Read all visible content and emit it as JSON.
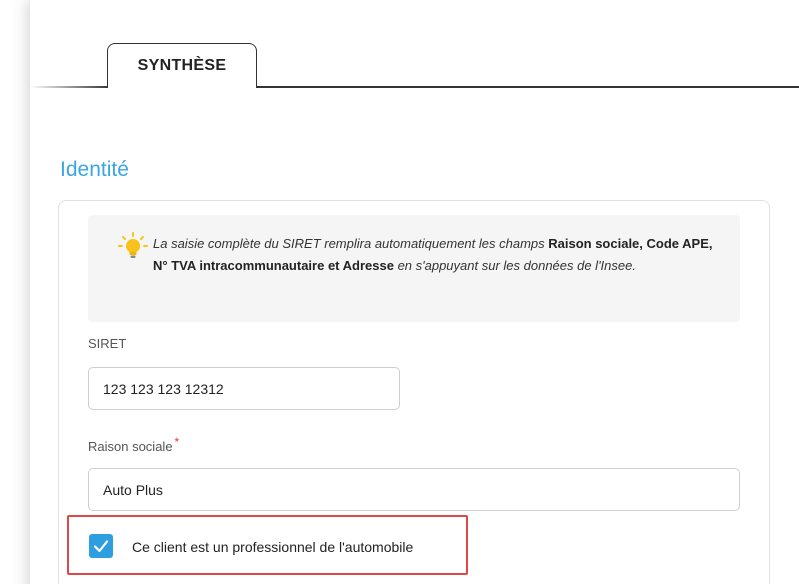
{
  "tabs": [
    {
      "label": "SYNTHÈSE",
      "active": true
    }
  ],
  "section": {
    "title": "Identité"
  },
  "info": {
    "icon": "lightbulb-icon",
    "part1": "La saisie complète du SIRET remplira automatiquement les champs ",
    "bold1": "Raison sociale, Code APE, N° TVA intracommunautaire et Adresse",
    "part2": " en s'appuyant sur les données de l'Insee."
  },
  "fields": {
    "siret": {
      "label": "SIRET",
      "value": "123 123 123 12312"
    },
    "raison_sociale": {
      "label": "Raison sociale",
      "required_mark": "*",
      "value": "Auto Plus"
    }
  },
  "checkbox": {
    "label": "Ce client est un professionnel de l'automobile",
    "checked": true
  },
  "colors": {
    "accent": "#3aa6e6",
    "checkbox": "#2f9ee0",
    "highlight": "#e04848",
    "required": "#e53935"
  }
}
